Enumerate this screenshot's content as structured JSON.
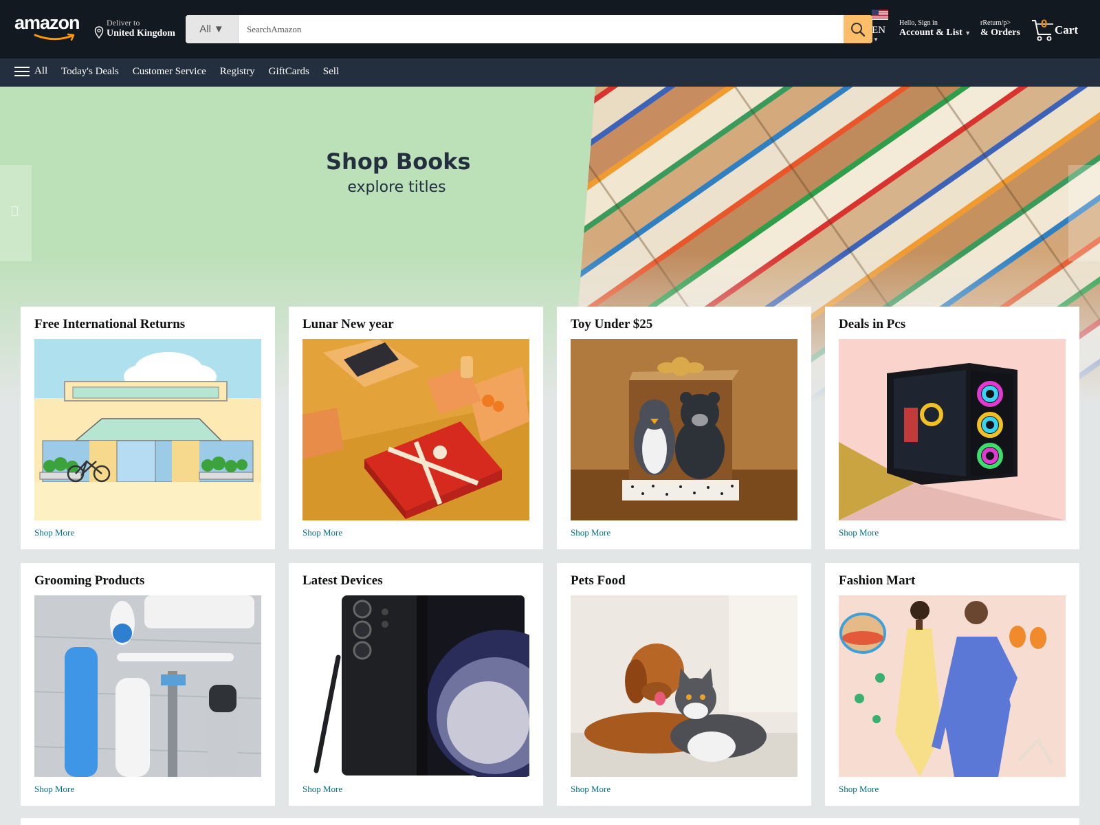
{
  "header": {
    "logo_text": "amazon",
    "deliver_line1": "Deliver to",
    "deliver_line2": "United Kingdom",
    "search_category": "All",
    "search_placeholder": "SearchAmazon",
    "language": "EN",
    "account_line1": "Hello, Sign in",
    "account_line2": "Account & List",
    "orders_line1": "rReturn/p>",
    "orders_line2": "& Orders",
    "cart_count": "0",
    "cart_label": "Cart"
  },
  "subnav": {
    "all_label": "All",
    "links": [
      "Today's Deals",
      "Customer Service",
      "Registry",
      "GiftCards",
      "Sell"
    ]
  },
  "hero": {
    "title": "Shop Books",
    "subtitle": "explore titles"
  },
  "cards": [
    {
      "title": "Free International Returns",
      "link": "Shop More"
    },
    {
      "title": "Lunar New year",
      "link": "Shop More"
    },
    {
      "title": "Toy Under $25",
      "link": "Shop More"
    },
    {
      "title": "Deals in Pcs",
      "link": "Shop More"
    },
    {
      "title": "Grooming Products",
      "link": "Shop More"
    },
    {
      "title": "Latest Devices",
      "link": "Shop More"
    },
    {
      "title": "Pets Food",
      "link": "Shop More"
    },
    {
      "title": "Fashion Mart",
      "link": "Shop More"
    }
  ],
  "colors": {
    "header_bg": "#131921",
    "subnav_bg": "#232f3e",
    "search_button": "#febd69",
    "cart_count": "#f08804",
    "link": "#007185",
    "hero_green": "#bce0b7"
  }
}
